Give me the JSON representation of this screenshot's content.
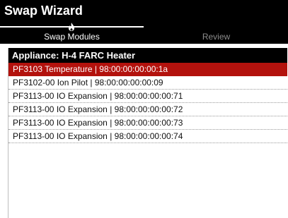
{
  "app": {
    "title": "Swap Wizard"
  },
  "tabs": [
    {
      "label": "Swap Modules",
      "active": true,
      "icon": "flame-icon"
    },
    {
      "label": "Review",
      "active": false
    }
  ],
  "appliance": {
    "header": "Appliance:  H-4 FARC Heater"
  },
  "modules": [
    {
      "label": "PF3103 Temperature  |  98:00:00:00:00:1a",
      "selected": true
    },
    {
      "label": "PF3102-00 Ion Pilot  |  98:00:00:00:00:09",
      "selected": false
    },
    {
      "label": "PF3113-00 IO Expansion  |  98:00:00:00:00:71",
      "selected": false
    },
    {
      "label": "PF3113-00 IO Expansion  |  98:00:00:00:00:72",
      "selected": false
    },
    {
      "label": "PF3113-00 IO Expansion  |  98:00:00:00:00:73",
      "selected": false
    },
    {
      "label": "PF3113-00 IO Expansion  |  98:00:00:00:00:74",
      "selected": false
    }
  ],
  "colors": {
    "titlebar_bg": "#000000",
    "selected_row_bg": "#b3120d",
    "inactive_tab_text": "#8c8c8c"
  }
}
